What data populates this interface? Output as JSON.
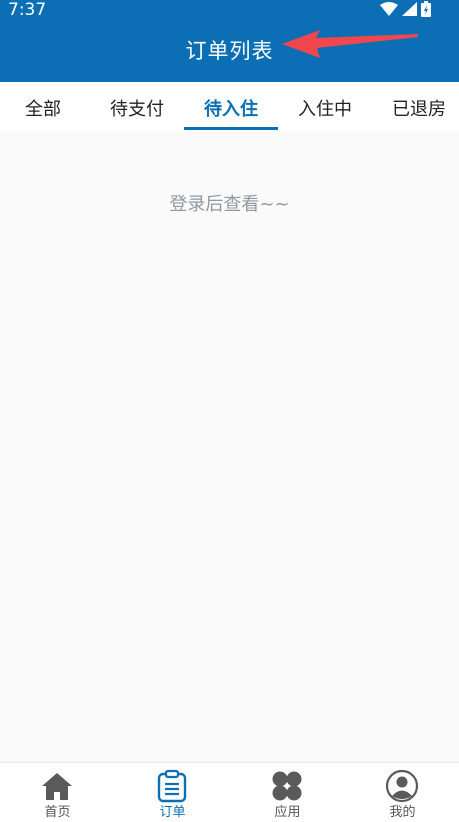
{
  "status_bar": {
    "time": "7:37"
  },
  "header": {
    "title": "订单列表"
  },
  "tabs": [
    {
      "label": "全部",
      "active": false
    },
    {
      "label": "待支付",
      "active": false
    },
    {
      "label": "待入住",
      "active": true
    },
    {
      "label": "入住中",
      "active": false
    },
    {
      "label": "已退房",
      "active": false
    }
  ],
  "content": {
    "empty_message": "登录后查看~~"
  },
  "bottom_nav": [
    {
      "label": "首页",
      "icon": "home-icon",
      "active": false
    },
    {
      "label": "订单",
      "icon": "order-list-icon",
      "active": true
    },
    {
      "label": "应用",
      "icon": "apps-icon",
      "active": false
    },
    {
      "label": "我的",
      "icon": "profile-icon",
      "active": false
    }
  ],
  "colors": {
    "primary": "#0c6fb6",
    "annotation_arrow": "#f0474f",
    "empty_text": "#8e99a3"
  }
}
